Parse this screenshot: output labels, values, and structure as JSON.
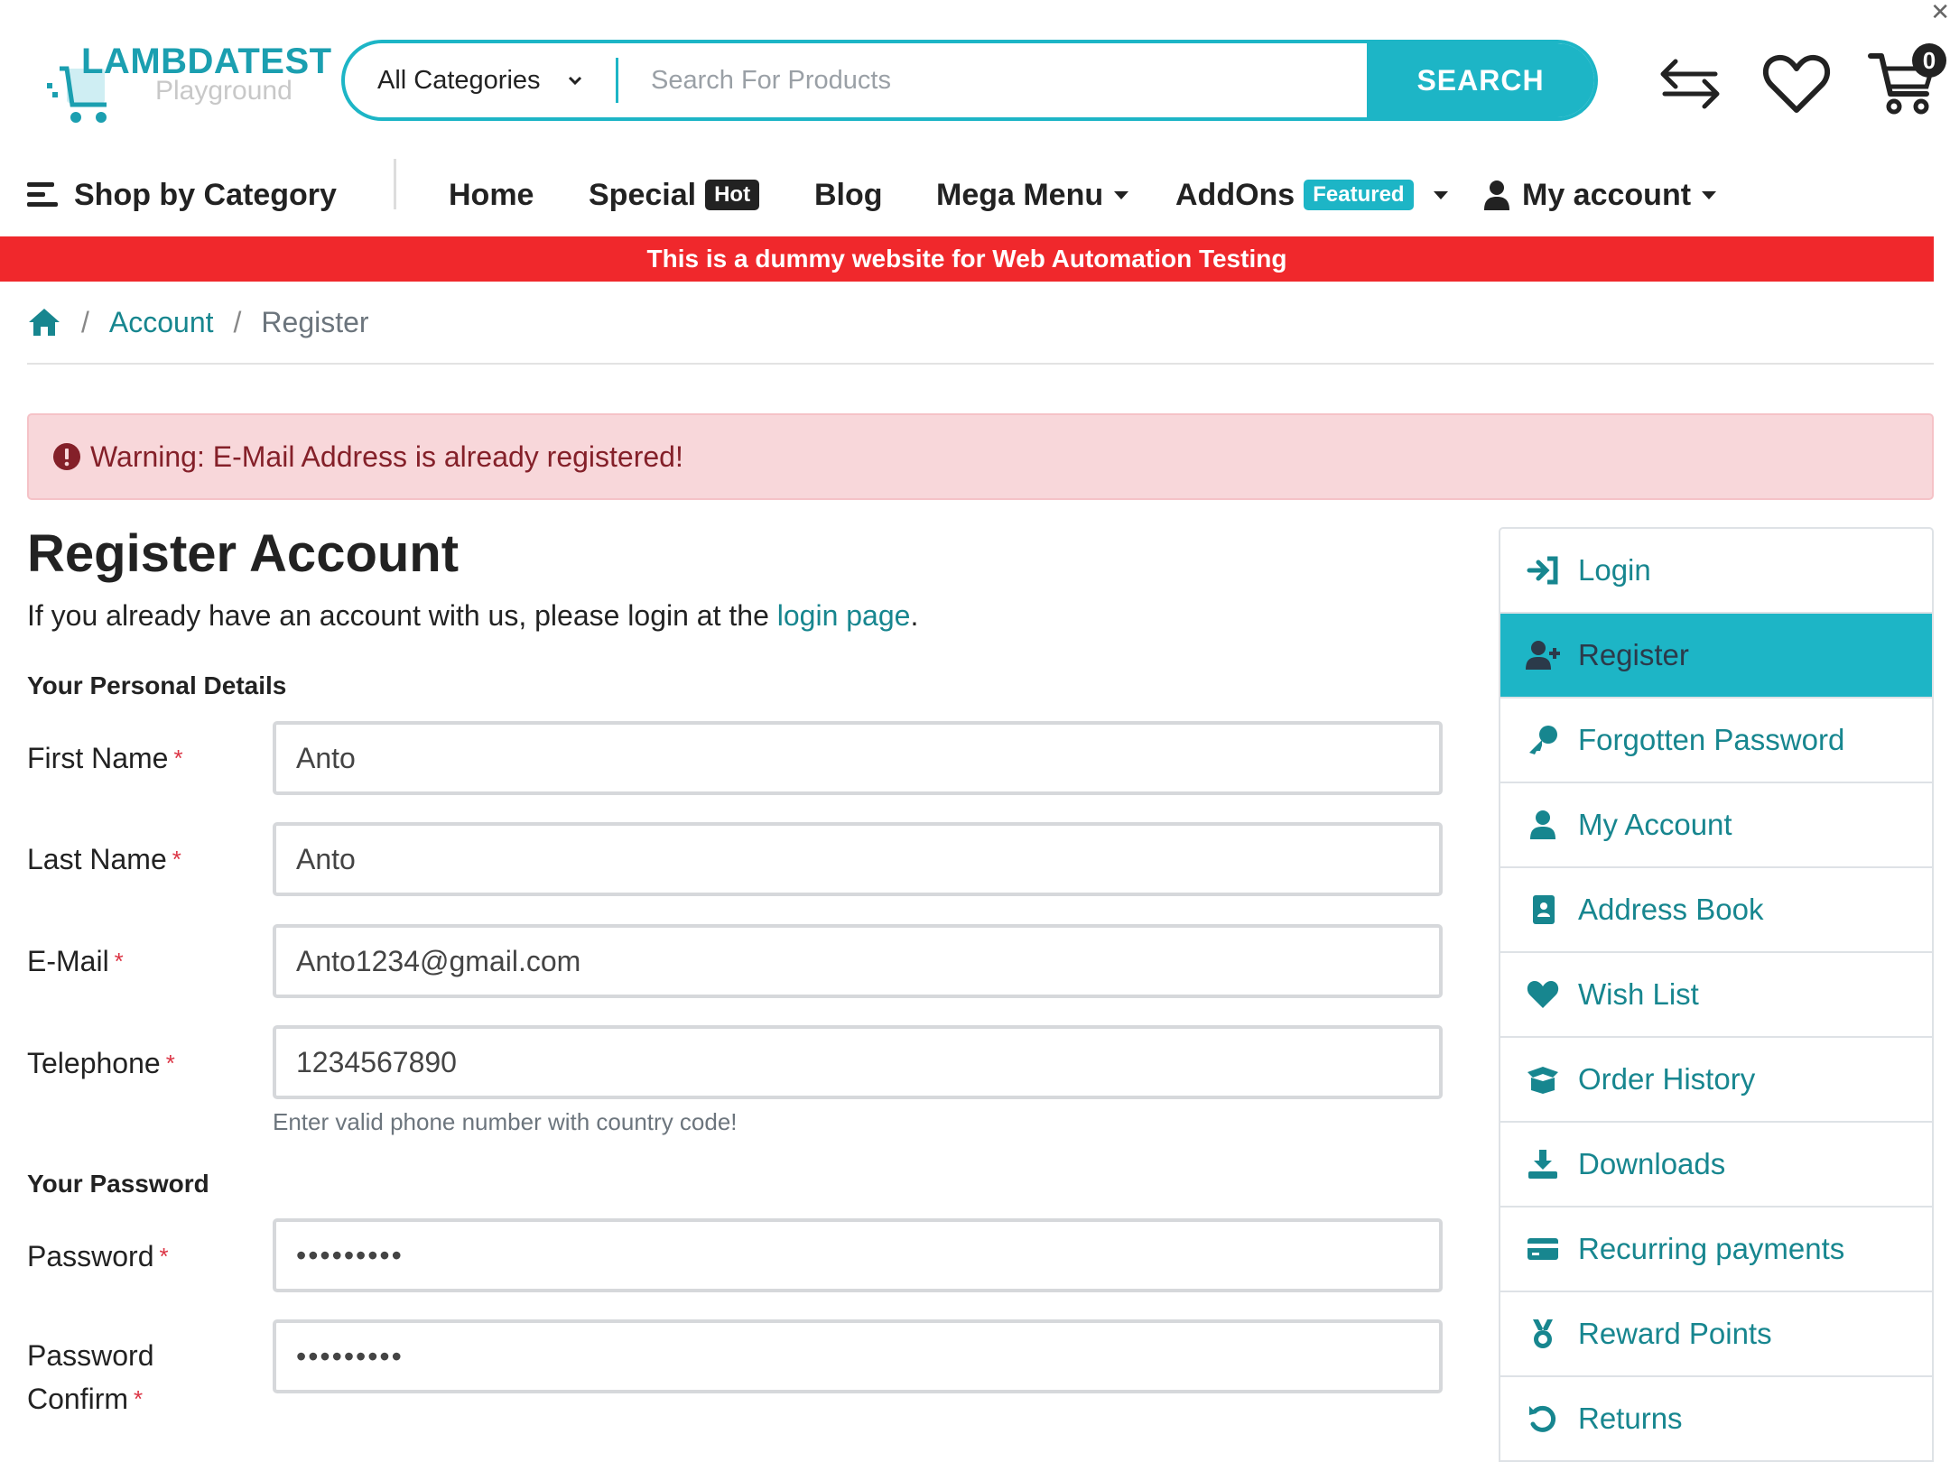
{
  "header": {
    "logo_title": "LAMBDATEST",
    "logo_subtitle": "Playground",
    "category_select": "All Categories",
    "search_placeholder": "Search For Products",
    "search_button": "SEARCH",
    "cart_count": "0",
    "brand_color": "#1db5c6"
  },
  "nav": {
    "shop_by_category": "Shop by Category",
    "home": "Home",
    "special": "Special",
    "special_badge": "Hot",
    "blog": "Blog",
    "mega_menu": "Mega Menu",
    "addons": "AddOns",
    "addons_badge": "Featured",
    "my_account": "My account"
  },
  "banner": {
    "text": "This is a dummy website for Web Automation Testing",
    "color": "#f0282c"
  },
  "breadcrumb": {
    "account": "Account",
    "current": "Register",
    "separator": "/"
  },
  "alert": {
    "text": "Warning: E-Mail Address is already registered!"
  },
  "form": {
    "title": "Register Account",
    "intro_text": "If you already have an account with us, please login at the ",
    "intro_link": "login page",
    "intro_end": ".",
    "personal_section": "Your Personal Details",
    "password_section": "Your Password",
    "required_mark": "*",
    "fields": {
      "first_name": {
        "label": "First Name",
        "value": "Anto"
      },
      "last_name": {
        "label": "Last Name",
        "value": "Anto"
      },
      "email": {
        "label": "E-Mail",
        "value": "Anto1234@gmail.com"
      },
      "telephone": {
        "label": "Telephone",
        "value": "1234567890",
        "help": "Enter valid phone number with country code!"
      },
      "password": {
        "label": "Password",
        "value": "•••••••••"
      },
      "password_confirm": {
        "label_line1": "Password",
        "label_line2": "Confirm",
        "value": "•••••••••"
      }
    }
  },
  "sidebar": {
    "items": [
      {
        "label": "Login",
        "icon": "sign-in-icon"
      },
      {
        "label": "Register",
        "icon": "user-plus-icon",
        "active": true
      },
      {
        "label": "Forgotten Password",
        "icon": "key-icon"
      },
      {
        "label": "My Account",
        "icon": "user-icon"
      },
      {
        "label": "Address Book",
        "icon": "address-book-icon"
      },
      {
        "label": "Wish List",
        "icon": "heart-icon"
      },
      {
        "label": "Order History",
        "icon": "box-open-icon"
      },
      {
        "label": "Downloads",
        "icon": "download-icon"
      },
      {
        "label": "Recurring payments",
        "icon": "credit-card-icon"
      },
      {
        "label": "Reward Points",
        "icon": "medal-icon"
      },
      {
        "label": "Returns",
        "icon": "undo-icon"
      }
    ]
  }
}
